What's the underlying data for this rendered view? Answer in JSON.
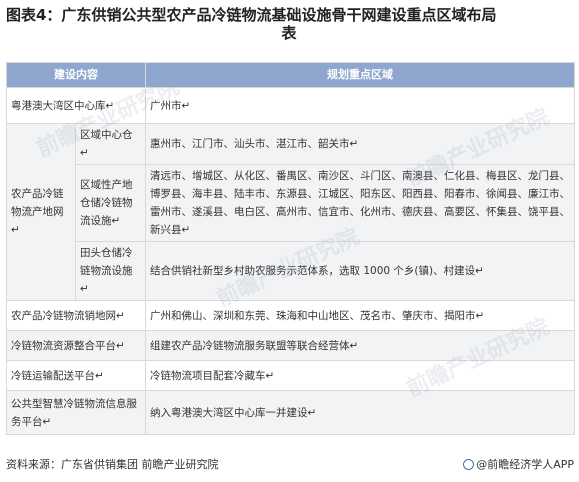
{
  "title_line1": "图表4：广东供销公共型农产品冷链物流基础设施骨干网建设重点区域布局",
  "title_line2": "表",
  "headers": {
    "col1": "建设内容",
    "col2": "规划重点区域"
  },
  "rows": {
    "r1": {
      "content": "粤港澳大湾区中心库↵",
      "area": "广州市↵"
    },
    "group": "农产品冷链物流产地网↵",
    "r2": {
      "sub": "区域中心仓↵",
      "area": "惠州市、江门市、汕头市、湛江市、韶关市↵"
    },
    "r3": {
      "sub": "区域性产地仓储冷链物流设施↵",
      "area": "清远市、增城区、从化区、番禺区、南沙区、斗门区、南澳县、仁化县、梅县区、龙门县、博罗县、海丰县、陆丰市、东源县、江城区、阳东区、阳西县、阳春市、徐闻县、廉江市、雷州市、遂溪县、电白区、高州市、信宜市、化州市、德庆县、高要区、怀集县、饶平县、新兴县↵"
    },
    "r4": {
      "sub": "田头仓储冷链物流设施↵",
      "area": "结合供销社新型乡村助农服务示范体系，选取 1000 个乡(镇)、村建设↵"
    },
    "r5": {
      "content": "农产品冷链物流销地网↵",
      "area": "广州和佛山、深圳和东莞、珠海和中山地区、茂名市、肇庆市、揭阳市↵"
    },
    "r6": {
      "content": "冷链物流资源整合平台↵",
      "area": "组建农产品冷链物流服务联盟等联合经营体↵"
    },
    "r7": {
      "content": "冷链运输配送平台↵",
      "area": "冷链物流项目配套冷藏车↵"
    },
    "r8": {
      "content": "公共型智慧冷链物流信息服务平台↵",
      "area": "纳入粤港澳大湾区中心库一并建设↵"
    }
  },
  "footer": {
    "source": "资料来源：广东省供销集团 前瞻产业研究院",
    "brand": "@前瞻经济学人APP"
  },
  "watermark": "前瞻产业研究院",
  "colors": {
    "header_bg": "#8fa6cf",
    "alt_row_bg": "#f2f3f5",
    "border": "#d9d9d9"
  }
}
